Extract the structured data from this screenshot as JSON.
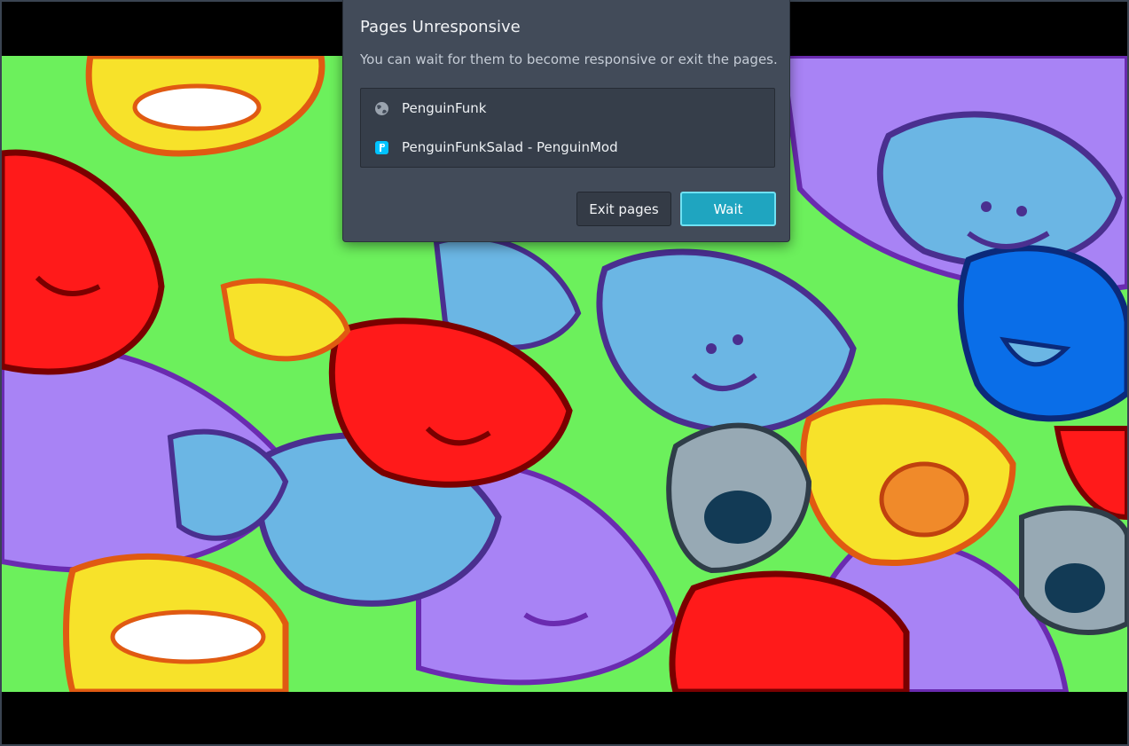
{
  "dialog": {
    "title": "Pages Unresponsive",
    "message": "You can wait for them to become responsive or exit the pages.",
    "pages": [
      {
        "label": "PenguinFunk",
        "icon": "globe-icon"
      },
      {
        "label": "PenguinFunkSalad - PenguinMod",
        "icon": "penguinmod-icon"
      }
    ],
    "buttons": {
      "exit_label": "Exit pages",
      "wait_label": "Wait"
    },
    "accent_color": "#1fa5c0"
  },
  "background": {
    "description_colors": [
      "#6cf05c",
      "#ff1a1a",
      "#f7e22a",
      "#a883f5",
      "#6bb6e4",
      "#0a6ee8",
      "#97a9b4"
    ]
  }
}
